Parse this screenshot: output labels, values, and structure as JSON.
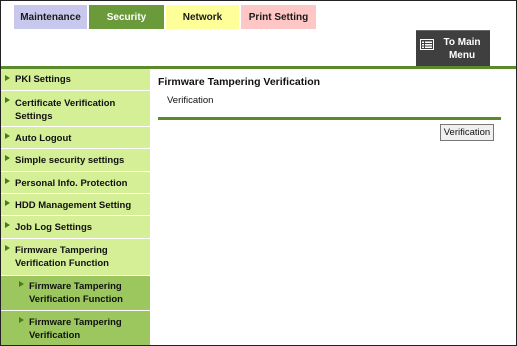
{
  "tabs": {
    "maintenance": "Maintenance",
    "security": "Security",
    "network": "Network",
    "print_setting": "Print Setting"
  },
  "header": {
    "main_menu_line1": "To Main",
    "main_menu_line2": "Menu",
    "main_menu_icon": "menu-list-icon"
  },
  "sidebar": {
    "items": [
      {
        "line1": "PKI Settings",
        "line2": ""
      },
      {
        "line1": "Certificate Verification",
        "line2": "Settings"
      },
      {
        "line1": "Auto Logout",
        "line2": ""
      },
      {
        "line1": "Simple security settings",
        "line2": ""
      },
      {
        "line1": "Personal Info. Protection",
        "line2": ""
      },
      {
        "line1": "HDD Management Setting",
        "line2": ""
      },
      {
        "line1": "Job Log Settings",
        "line2": ""
      },
      {
        "line1": "Firmware Tampering",
        "line2": "Verification Function"
      },
      {
        "line1": "Firmware Tampering",
        "line2": "Verification Function"
      },
      {
        "line1": "Firmware Tampering",
        "line2": "Verification"
      }
    ]
  },
  "main": {
    "title": "Firmware Tampering Verification",
    "subtitle": "Verification",
    "verify_button": "Verification"
  },
  "colors": {
    "accent_green": "#5a8a2a",
    "sidebar_bg": "#d4ef96",
    "sidebar_sub_bg": "#9bc75e",
    "security_tab": "#6a9a3a"
  }
}
